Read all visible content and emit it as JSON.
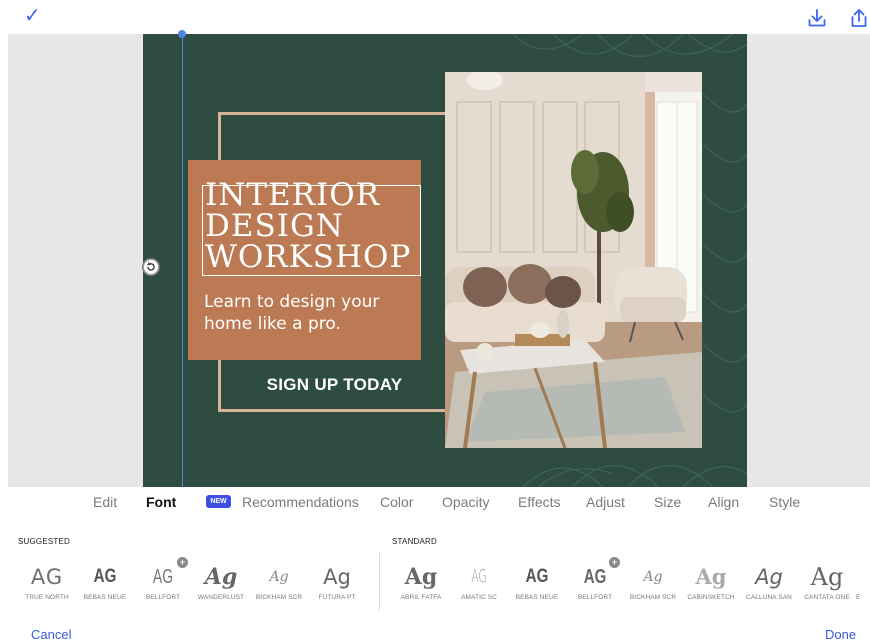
{
  "header": {
    "confirm_icon": "checkmark-icon",
    "download_icon": "download-icon",
    "share_icon": "share-icon",
    "accent_color": "#3b66f2"
  },
  "design": {
    "title_line1": "INTERIOR",
    "title_line2": "DESIGN",
    "title_line3": "WORKSHOP",
    "subtitle_line1": "Learn to design your",
    "subtitle_line2": "home like a pro.",
    "cta": "SIGN UP TODAY",
    "background_color": "#2e4d40",
    "card_color": "#bb7a53",
    "frame_color": "#d8b59a"
  },
  "tabs": {
    "edit": "Edit",
    "font": "Font",
    "new_badge": "NEW",
    "recommendations": "Recommendations",
    "color": "Color",
    "opacity": "Opacity",
    "effects": "Effects",
    "adjust": "Adjust",
    "size": "Size",
    "align": "Align",
    "style": "Style",
    "active": "Font"
  },
  "fonts": {
    "suggested_label": "SUGGESTED",
    "standard_label": "STANDARD",
    "suggested": [
      {
        "sample": "AG",
        "name": "TRUE NORTH"
      },
      {
        "sample": "AG",
        "name": "BEBAS NEUE"
      },
      {
        "sample": "AG",
        "name": "BELLFORT",
        "premium": true
      },
      {
        "sample": "Ag",
        "name": "WANDERLUST"
      },
      {
        "sample": "Ag",
        "name": "BICKHAM SCR"
      },
      {
        "sample": "Ag",
        "name": "FUTURA PT"
      }
    ],
    "standard": [
      {
        "sample": "Ag",
        "name": "ABRIL FATFA"
      },
      {
        "sample": "AG",
        "name": "AMATIC SC"
      },
      {
        "sample": "AG",
        "name": "BEBAS NEUE"
      },
      {
        "sample": "AG",
        "name": "BELLFORT",
        "premium": true
      },
      {
        "sample": "Ag",
        "name": "BICKHAM SCR"
      },
      {
        "sample": "Ag",
        "name": "CABINSKETCH"
      },
      {
        "sample": "Ag",
        "name": "CALLUNA SAN"
      },
      {
        "sample": "Ag",
        "name": "CANTATA ONE"
      },
      {
        "sample": "E",
        "name": "E"
      }
    ]
  },
  "footer": {
    "cancel": "Cancel",
    "done": "Done"
  }
}
